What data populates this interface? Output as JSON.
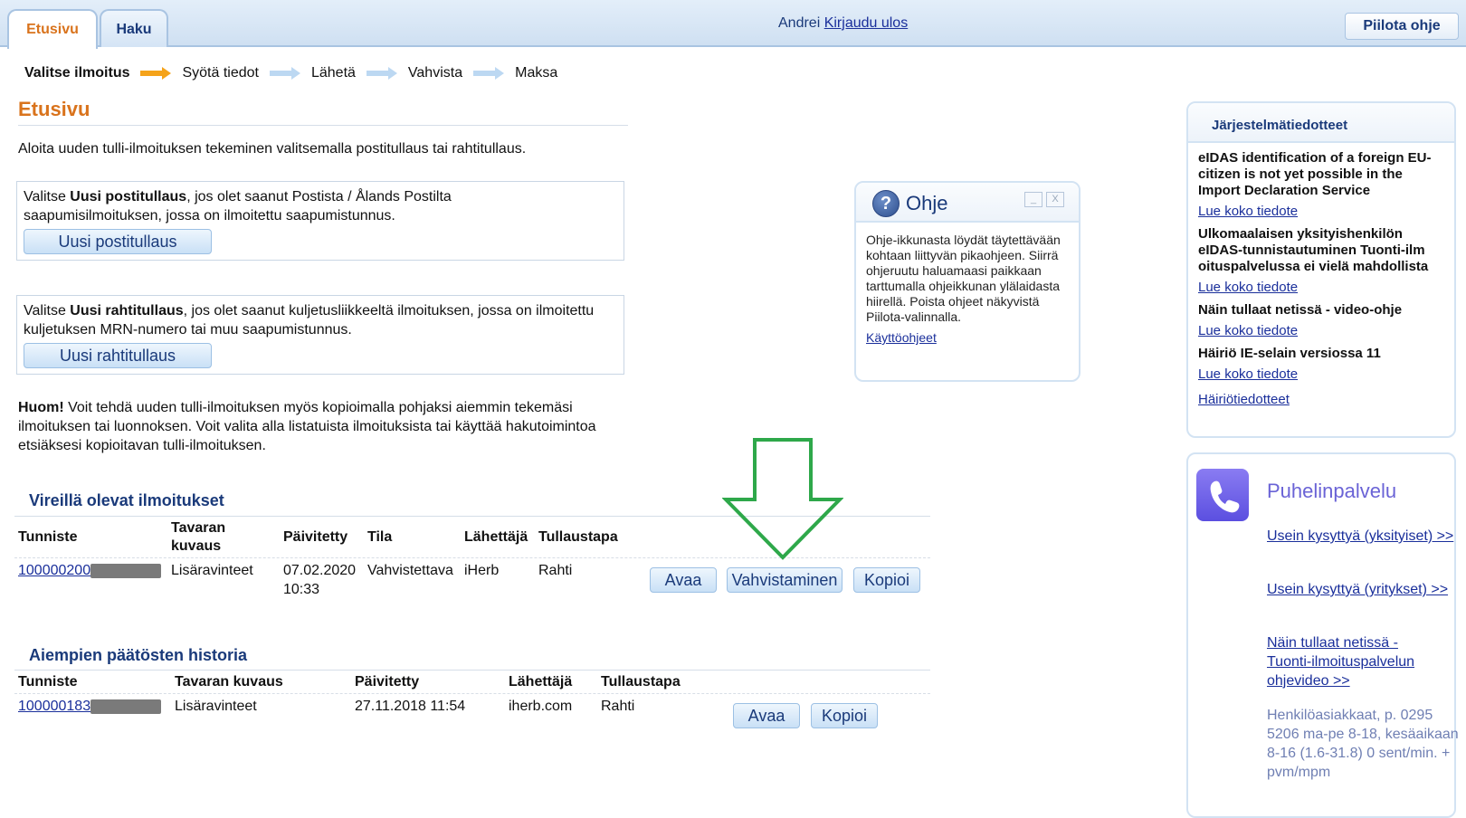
{
  "topbar": {
    "tabs": [
      {
        "label": "Etusivu"
      },
      {
        "label": "Haku"
      }
    ],
    "user_name": "Andrei",
    "logout": "Kirjaudu ulos",
    "hide_help": "Piilota ohje"
  },
  "steps": [
    "Valitse ilmoitus",
    "Syötä tiedot",
    "Lähetä",
    "Vahvista",
    "Maksa"
  ],
  "page": {
    "title": "Etusivu",
    "intro": "Aloita uuden tulli-ilmoituksen tekeminen valitsemalla postitullaus tai rahtitullaus.",
    "post": {
      "text_prefix": "Valitse ",
      "text_bold": "Uusi postitullaus",
      "text_suffix": ", jos olet saanut Postista / Ålands Postilta saapumisilmoituksen, jossa on ilmoitettu saapumistunnus.",
      "button": "Uusi postitullaus"
    },
    "freight": {
      "text_prefix": "Valitse ",
      "text_bold": "Uusi rahtitullaus",
      "text_suffix": ", jos olet saanut kuljetusliikkeeltä ilmoituksen, jossa on ilmoitettu kuljetuksen MRN-numero tai muu saapumistunnus.",
      "button": "Uusi rahtitullaus"
    },
    "note_bold": "Huom!",
    "note": " Voit tehdä uuden tulli-ilmoituksen myös kopioimalla pohjaksi aiemmin tekemäsi ilmoituksen tai luonnoksen. Voit valita alla listatuista ilmoituksista tai käyttää hakutoimintoa etsiäksesi kopioitavan tulli-ilmoituksen."
  },
  "pending": {
    "title": "Vireillä olevat ilmoitukset",
    "headers": [
      "Tunniste",
      "Tavaran kuvaus",
      "Päivitetty",
      "Tila",
      "Lähettäjä",
      "Tullaustapa"
    ],
    "rows": [
      {
        "id": "100000200",
        "desc": "Lisäravinteet",
        "date": "07.02.2020 10:33",
        "status": "Vahvistettava",
        "sender": "iHerb",
        "method": "Rahti",
        "actions": [
          "Avaa",
          "Vahvistaminen",
          "Kopioi"
        ]
      }
    ]
  },
  "history": {
    "title": "Aiempien päätösten historia",
    "headers": [
      "Tunniste",
      "Tavaran kuvaus",
      "Päivitetty",
      "Lähettäjä",
      "Tullaustapa"
    ],
    "rows": [
      {
        "id": "100000183",
        "desc": "Lisäravinteet",
        "date": "27.11.2018 11:54",
        "sender": "iherb.com",
        "method": "Rahti",
        "actions": [
          "Avaa",
          "Kopioi"
        ]
      }
    ]
  },
  "help": {
    "title": "Ohje",
    "text": "Ohje-ikkunasta löydät täytettävään kohtaan liittyvän pikaohjeen. Siirrä ohjeruutu haluamaasi paikkaan tarttumalla ohjeikkunan ylälaidasta hiirellä. Poista ohjeet näkyvistä Piilota-valinnalla.",
    "link": "Käyttöohjeet",
    "minimize": "_",
    "close": "X"
  },
  "notices": {
    "title": "Järjestelmätiedotteet",
    "items": [
      {
        "title": "eIDAS identification of a foreign EU-citizen is not yet possible in the Import Declaration Service",
        "link": "Lue koko tiedote"
      },
      {
        "title": "Ulkomaalaisen yksityishenkilön eIDAS-tunnistautuminen Tuonti-ilm oituspalvelussa ei vielä mahdollista",
        "link": "Lue koko tiedote"
      },
      {
        "title": "Näin tullaat netissä - video-ohje",
        "link": "Lue koko tiedote"
      },
      {
        "title": "Häiriö IE-selain versiossa 11",
        "link": "Lue koko tiedote"
      }
    ],
    "disturbances": "Häiriötiedotteet"
  },
  "phone": {
    "title": "Puhelinpalvelu",
    "links": [
      "Usein kysyttyä (yksityiset) >>",
      "Usein kysyttyä (yritykset) >>",
      "Näin tullaat netissä - Tuonti-ilmoituspalvelun ohjevideo >>"
    ],
    "info": "Henkilöasiakkaat, p. 0295 5206 ma-pe 8-18, kesäaikaan 8-16 (1.6-31.8) 0 sent/min. + pvm/mpm"
  },
  "colors": {
    "accent": "#d9731c",
    "nav": "#1a3a7a",
    "annotation_arrow": "#2ea84a"
  }
}
